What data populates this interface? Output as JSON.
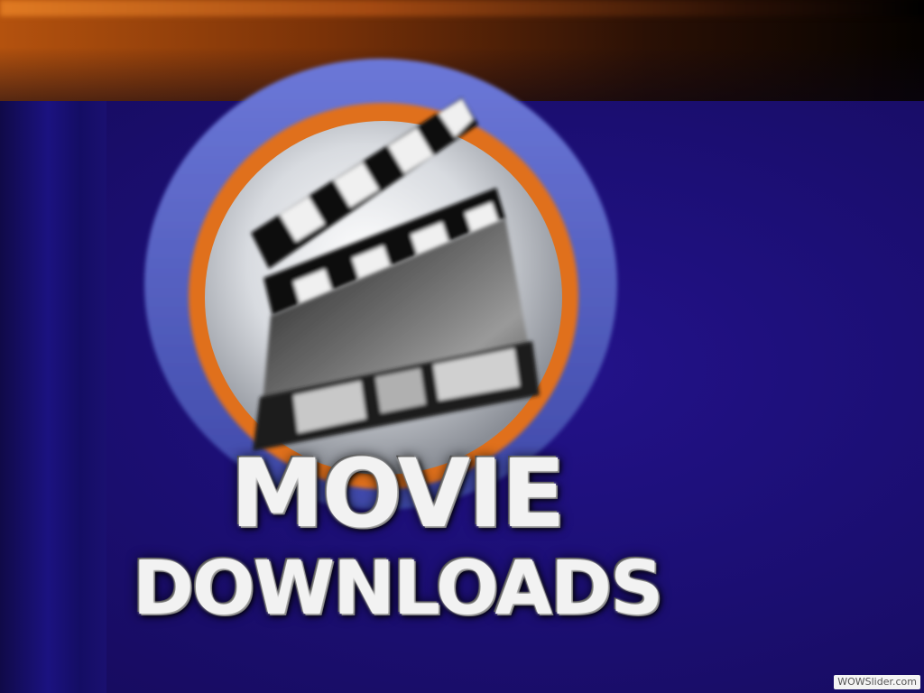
{
  "logo": {
    "line1": "MOVIE",
    "line2": "DOWNLOADS",
    "icon": "clapperboard-icon"
  },
  "watermark": {
    "text": "WOWSlider.com"
  },
  "colors": {
    "background": "#1a1070",
    "top_band": "#b4520e",
    "ring_outer": "#5a66c8",
    "ring_orange": "#e0701a",
    "text": "#f2f2f2"
  }
}
